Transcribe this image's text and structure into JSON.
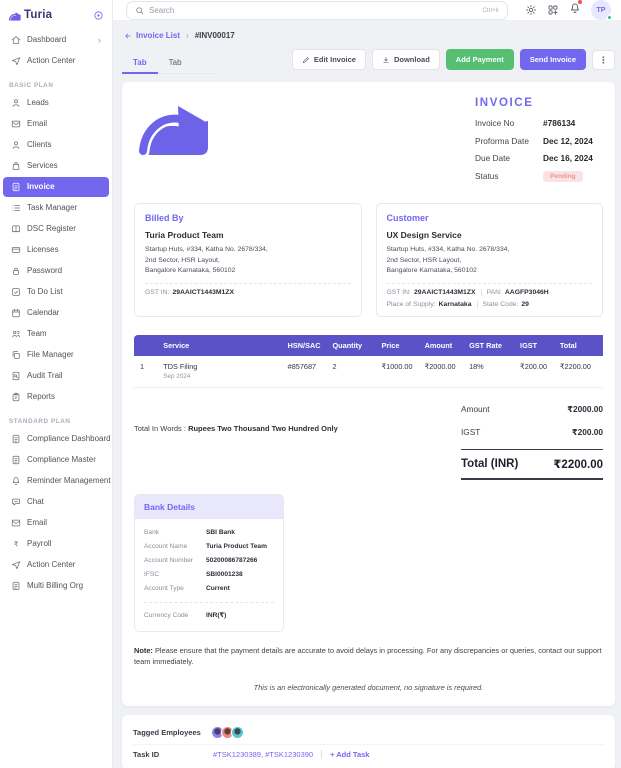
{
  "brand": {
    "name": "Turia"
  },
  "colors": {
    "accent": "#7367F0",
    "table_header": "#5A52C6",
    "green_button": "#56BF73",
    "pending_bg": "#FBE3E3",
    "pending_text": "#EF9494"
  },
  "icons": {
    "chevron_right": "›",
    "breadcrumb_sep": "›",
    "back_arrow": "←",
    "dots_vertical": "⋮"
  },
  "header": {
    "search_placeholder": "Search",
    "search_shortcut": "Ctrl+k",
    "avatar_initials": "TP"
  },
  "sidebar": {
    "top_items": [
      {
        "label": "Dashboard",
        "icon": "home",
        "chevron": true
      },
      {
        "label": "Action Center",
        "icon": "send"
      }
    ],
    "sections": [
      {
        "title": "BASIC PLAN",
        "items": [
          {
            "label": "Leads",
            "icon": "user"
          },
          {
            "label": "Email",
            "icon": "mail"
          },
          {
            "label": "Clients",
            "icon": "user"
          },
          {
            "label": "Services",
            "icon": "cart"
          },
          {
            "label": "Invoice",
            "icon": "file",
            "active": true
          },
          {
            "label": "Task Manager",
            "icon": "list"
          },
          {
            "label": "DSC Register",
            "icon": "book"
          },
          {
            "label": "Licenses",
            "icon": "card"
          },
          {
            "label": "Password",
            "icon": "lock"
          },
          {
            "label": "To Do List",
            "icon": "check"
          },
          {
            "label": "Calendar",
            "icon": "cal"
          },
          {
            "label": "Team",
            "icon": "users"
          },
          {
            "label": "File Manager",
            "icon": "copy"
          },
          {
            "label": "Audit Trail",
            "icon": "filesearch"
          },
          {
            "label": "Reports",
            "icon": "clipboard"
          }
        ]
      },
      {
        "title": "STANDARD PLAN",
        "items": [
          {
            "label": "Compliance Dashboard",
            "icon": "file"
          },
          {
            "label": "Compliance Master",
            "icon": "file"
          },
          {
            "label": "Reminder Management",
            "icon": "bell"
          },
          {
            "label": "Chat",
            "icon": "chat"
          },
          {
            "label": "Email",
            "icon": "mail"
          },
          {
            "label": "Payroll",
            "icon": "rupee"
          },
          {
            "label": "Action Center",
            "icon": "send"
          },
          {
            "label": "Multi Billing Org",
            "icon": "file"
          }
        ]
      }
    ]
  },
  "breadcrumb": {
    "back": "Invoice List",
    "current": "#INV00017"
  },
  "tabs": [
    {
      "label": "Tab",
      "active": true
    },
    {
      "label": "Tab"
    }
  ],
  "toolbar": {
    "edit": "Edit Invoice",
    "download": "Download",
    "add_payment": "Add Payment",
    "send": "Send Invoice"
  },
  "invoice": {
    "title": "INVOICE",
    "meta": [
      {
        "label": "Invoice No",
        "value": "#786134"
      },
      {
        "label": "Proforma Date",
        "value": "Dec 12, 2024"
      },
      {
        "label": "Due Date",
        "value": "Dec 16, 2024"
      }
    ],
    "status_label": "Status",
    "status": "Pending",
    "billed_by": {
      "heading": "Billed By",
      "name": "Turia Product Team",
      "address_lines": [
        "Startup Huts, #334,  Katha No. 2678/334,",
        "2nd Sector, HSR Layout,",
        "Bangalore Karnataka, 560102"
      ],
      "gst_label": "GST IN:",
      "gst": "29AAICT1443M1ZX"
    },
    "customer": {
      "heading": "Customer",
      "name": "UX Design Service",
      "address_lines": [
        "Startup Huts, #334,  Katha No. 2678/334,",
        "2nd Sector, HSR Layout,",
        "Bangalore Karnataka, 560102"
      ],
      "gst_label": "GST IN:",
      "gst": "29AAICT1443M1ZX",
      "pan_label": "PAN:",
      "pan": "AAGFP3046H",
      "supply_label": "Place of Supply:",
      "supply": "Karnataka",
      "state_label": "State Code:",
      "state": "29"
    },
    "table": {
      "headers": [
        "",
        "Service",
        "HSN/SAC",
        "Quantity",
        "Price",
        "Amount",
        "GST Rate",
        "IGST",
        "Total"
      ],
      "row": {
        "num": "1",
        "service": "TDS Filing",
        "period": "Sep 2024",
        "hsn": "#857687",
        "qty": "2",
        "price": "₹1000.00",
        "amount": "₹2000.00",
        "gst_rate": "18%",
        "igst": "₹200.00",
        "total": "₹2200.00"
      }
    },
    "total_words_label": "Total In Words : ",
    "total_words": "Rupees Two Thousand Two Hundred Only",
    "summary": [
      {
        "label": "Amount",
        "value": "₹2000.00"
      },
      {
        "label": "IGST",
        "value": "₹200.00"
      }
    ],
    "total_label": "Total (INR)",
    "total_value": "₹2200.00",
    "bank": {
      "heading": "Bank Details",
      "rows": [
        {
          "label": "Bank",
          "value": "SBI Bank"
        },
        {
          "label": "Account Name",
          "value": "Turia Product Team"
        },
        {
          "label": "Account Number",
          "value": "50200086787266"
        },
        {
          "label": "IFSC",
          "value": "SBI0001238"
        },
        {
          "label": "Account Type",
          "value": "Current"
        }
      ],
      "currency_row": {
        "label": "Currency Code",
        "value": "INR(₹)"
      }
    },
    "note_label": "Note:",
    "note_text": " Please ensure that the payment details are accurate to avoid delays in processing. For any discrepancies or queries, contact our support team immediately.",
    "disclaimer": "This is an electronically generated document, no signature is required."
  },
  "footer": {
    "tagged_label": "Tagged Employees",
    "task_label": "Task ID",
    "task_ids": "#TSK1230389,  #TSK1230390",
    "add_task": "+ Add Task"
  }
}
